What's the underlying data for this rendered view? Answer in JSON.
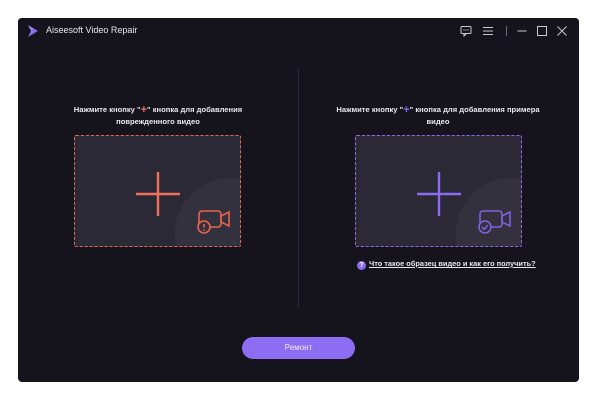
{
  "window": {
    "title": "Aiseesoft Video Repair"
  },
  "titlebar_icons": [
    "feedback-icon",
    "menu-icon",
    "minimize-icon",
    "maximize-icon",
    "close-icon"
  ],
  "left_panel": {
    "prompt_before": "Нажмите кнопку \"",
    "prompt_after": "\" кнопка для добавления",
    "prompt_line2": "поврежденного видео",
    "accent_color": "#f0715a"
  },
  "right_panel": {
    "prompt_before": "Нажмите кнопку \"",
    "prompt_after": "\" кнопка для добавления примера",
    "prompt_line2": "видео",
    "accent_color": "#8b6cf0"
  },
  "help": {
    "icon": "?",
    "text": "Что такое образец видео и как его получить?"
  },
  "repair_button": {
    "label": "Ремонт"
  },
  "plus_glyph": "+"
}
